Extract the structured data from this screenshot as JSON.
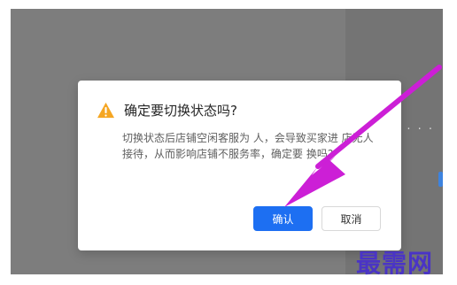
{
  "dialog": {
    "title": "确定要切换状态吗?",
    "body": "切换状态后店铺空闲客服为 人，会导致买家进 店无人接待，从而影响店铺不服务率，确定要 换吗?",
    "confirm_label": "确认",
    "cancel_label": "取消"
  },
  "background": {
    "dots_text": "· · ·"
  },
  "watermark": {
    "text": "最需网"
  },
  "colors": {
    "overlay": "#7d7d7d",
    "primary_button": "#1d6ff2",
    "warning_icon": "#f5a623",
    "annotation_arrow": "#cc1fd6",
    "watermark": "#4a34c5"
  },
  "icons": {
    "warning": "warning-icon"
  }
}
